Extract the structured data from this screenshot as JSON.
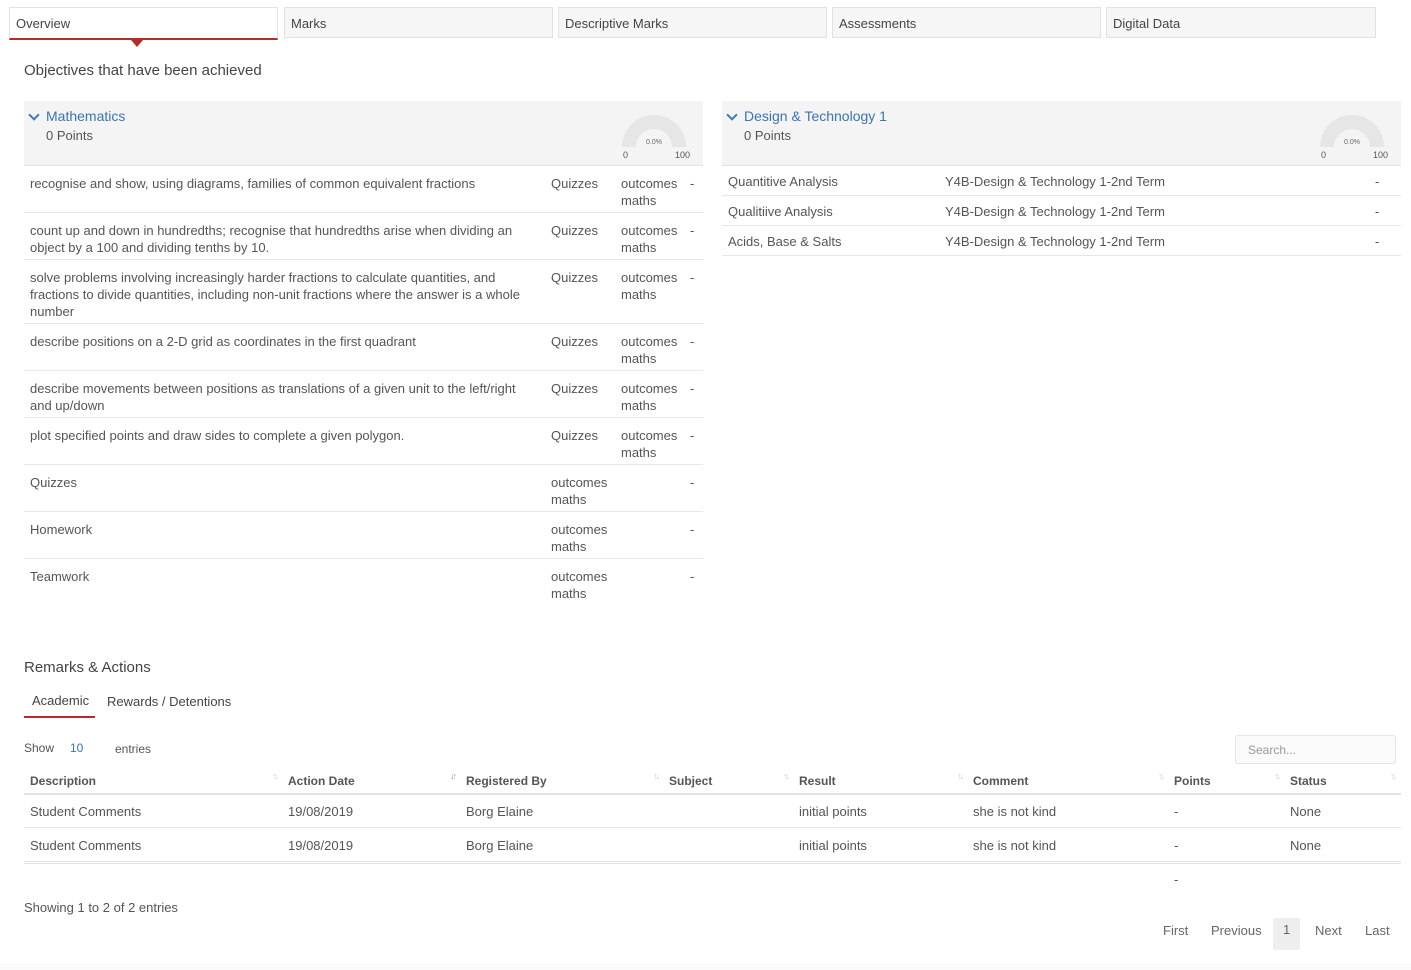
{
  "tabs": [
    {
      "label": "Overview",
      "active": true
    },
    {
      "label": "Marks",
      "active": false
    },
    {
      "label": "Descriptive Marks",
      "active": false
    },
    {
      "label": "Assessments",
      "active": false
    },
    {
      "label": "Digital Data",
      "active": false
    }
  ],
  "objectives_heading": "Objectives that have been achieved",
  "subjects": [
    {
      "title": "Mathematics",
      "points": "0 Points",
      "gauge": {
        "percent_label": "0.0%",
        "min": "0",
        "max": "100",
        "value": 0
      },
      "rows": [
        {
          "objective": "recognise and show, using diagrams, families of common equivalent fractions",
          "type": "Quizzes",
          "category": "outcomes maths",
          "mark": "-"
        },
        {
          "objective": "count up and down in hundredths; recognise that hundredths arise when dividing an object by a 100 and dividing tenths by 10.",
          "type": "Quizzes",
          "category": "outcomes maths",
          "mark": "-"
        },
        {
          "objective": "solve problems involving increasingly harder fractions to calculate quantities, and fractions to divide quantities, including non-unit fractions where the answer is a whole number",
          "type": "Quizzes",
          "category": "outcomes maths",
          "mark": "-"
        },
        {
          "objective": "describe positions on a 2-D grid as coordinates in the first quadrant",
          "type": "Quizzes",
          "category": "outcomes maths",
          "mark": "-"
        },
        {
          "objective": "describe movements between positions as translations of a given unit to the left/right and up/down",
          "type": "Quizzes",
          "category": "outcomes maths",
          "mark": "-"
        },
        {
          "objective": "plot specified points and draw sides to complete a given polygon.",
          "type": "Quizzes",
          "category": "outcomes maths",
          "mark": "-"
        }
      ],
      "summary_rows": [
        {
          "name": "Quizzes",
          "category": "outcomes maths",
          "mark": "-"
        },
        {
          "name": "Homework",
          "category": "outcomes maths",
          "mark": "-"
        },
        {
          "name": "Teamwork",
          "category": "outcomes maths",
          "mark": "-"
        }
      ]
    },
    {
      "title": "Design & Technology 1",
      "points": "0 Points",
      "gauge": {
        "percent_label": "0.0%",
        "min": "0",
        "max": "100",
        "value": 0
      },
      "rows": [
        {
          "objective": "Quantitive Analysis",
          "term": "Y4B-Design & Technology 1-2nd Term",
          "mark": "-"
        },
        {
          "objective": "Qualitiive Analysis",
          "term": "Y4B-Design & Technology 1-2nd Term",
          "mark": "-"
        },
        {
          "objective": "Acids, Base & Salts",
          "term": "Y4B-Design & Technology 1-2nd Term",
          "mark": "-"
        }
      ]
    }
  ],
  "remarks": {
    "heading": "Remarks & Actions",
    "subtabs": [
      {
        "label": "Academic",
        "active": true
      },
      {
        "label": "Rewards / Detentions",
        "active": false
      }
    ],
    "show_label": "Show",
    "page_size": "10",
    "entries_label": "entries",
    "search_placeholder": "Search...",
    "columns": [
      "Description",
      "Action Date",
      "Registered By",
      "Subject",
      "Result",
      "Comment",
      "Points",
      "Status"
    ],
    "rows": [
      {
        "description": "Student Comments",
        "action_date": "19/08/2019",
        "registered_by": "Borg Elaine",
        "subject": "",
        "result": "initial points",
        "comment": "she is not kind",
        "points": "-",
        "status": "None"
      },
      {
        "description": "Student Comments",
        "action_date": "19/08/2019",
        "registered_by": "Borg Elaine",
        "subject": "",
        "result": "initial points",
        "comment": "she is not kind",
        "points": "-",
        "status": "None"
      }
    ],
    "total_points": "-",
    "info": "Showing 1 to 2 of 2 entries",
    "pagination": {
      "first": "First",
      "previous": "Previous",
      "current": "1",
      "next": "Next",
      "last": "Last"
    }
  },
  "colors": {
    "accent": "#b52a2a",
    "link": "#3a74b4"
  }
}
